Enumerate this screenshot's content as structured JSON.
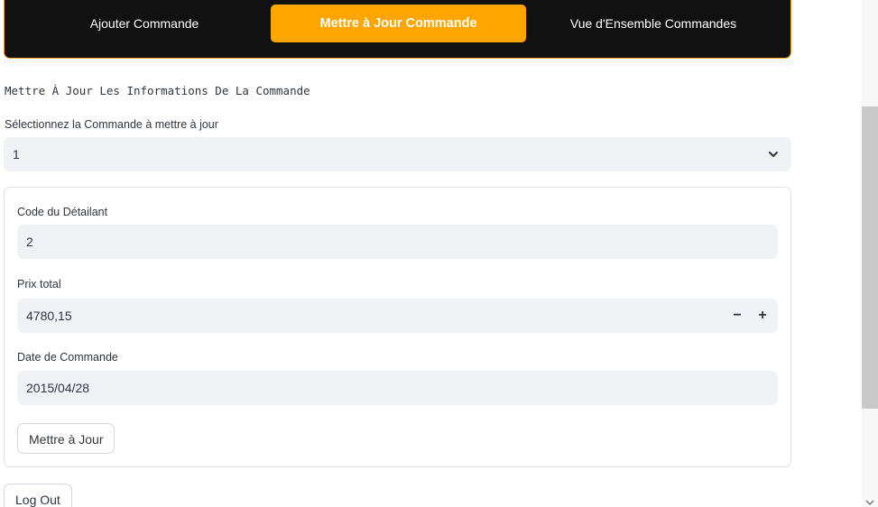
{
  "nav": {
    "tabs": [
      {
        "label": "Ajouter Commande",
        "active": false
      },
      {
        "label": "Mettre à Jour Commande",
        "active": true
      },
      {
        "label": "Vue d'Ensemble Commandes",
        "active": false
      }
    ],
    "active_color": "#ffa500",
    "bar_color": "#111111"
  },
  "main": {
    "subtitle": "Mettre À Jour Les Informations De La Commande",
    "select": {
      "label": "Sélectionnez la Commande à mettre à jour",
      "value": "1",
      "icon": "chevron-down-icon"
    },
    "form": {
      "retailer_code": {
        "label": "Code du Détailant",
        "value": "2"
      },
      "total_price": {
        "label": "Prix total",
        "value": "4780,15",
        "minus": "−",
        "plus": "+"
      },
      "order_date": {
        "label": "Date de Commande",
        "value": "2015/04/28"
      },
      "submit_label": "Mettre à Jour"
    },
    "logout_label": "Log Out"
  }
}
